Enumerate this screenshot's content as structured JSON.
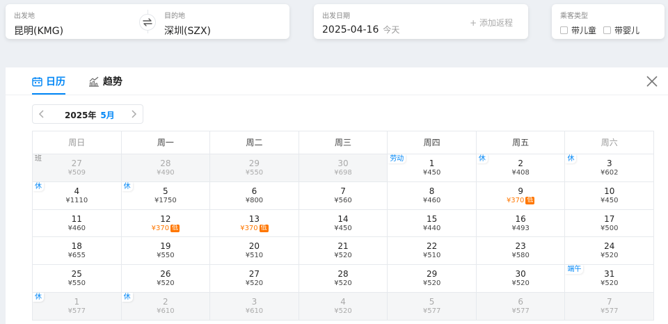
{
  "search": {
    "departure": {
      "label": "出发地",
      "value": "昆明(KMG)"
    },
    "arrival": {
      "label": "目的地",
      "value": "深圳(SZX)"
    },
    "date": {
      "label": "出发日期",
      "value": "2025-04-16",
      "today_tag": "今天"
    },
    "add_return": "+ 添加返程",
    "passenger": {
      "label": "乘客类型",
      "options": [
        "带儿童",
        "带婴儿"
      ]
    }
  },
  "panel": {
    "tabs": {
      "calendar": "日历",
      "trend": "趋势"
    },
    "year": "2025年",
    "month": "5月",
    "weekdays": [
      "周日",
      "周一",
      "周二",
      "周三",
      "周四",
      "周五",
      "周六"
    ],
    "weeks": [
      [
        {
          "day": "27",
          "price": "¥509",
          "dim": true,
          "tag": "班"
        },
        {
          "day": "28",
          "price": "¥490",
          "dim": true
        },
        {
          "day": "29",
          "price": "¥550",
          "dim": true
        },
        {
          "day": "30",
          "price": "¥698",
          "dim": true
        },
        {
          "day": "1",
          "price": "¥450",
          "tag": "劳动"
        },
        {
          "day": "2",
          "price": "¥408",
          "tag": "休"
        },
        {
          "day": "3",
          "price": "¥602",
          "tag": "休"
        }
      ],
      [
        {
          "day": "4",
          "price": "¥1110",
          "tag": "休"
        },
        {
          "day": "5",
          "price": "¥1750",
          "tag": "休"
        },
        {
          "day": "6",
          "price": "¥800"
        },
        {
          "day": "7",
          "price": "¥560"
        },
        {
          "day": "8",
          "price": "¥460"
        },
        {
          "day": "9",
          "price": "¥370",
          "low": true
        },
        {
          "day": "10",
          "price": "¥450"
        }
      ],
      [
        {
          "day": "11",
          "price": "¥460"
        },
        {
          "day": "12",
          "price": "¥370",
          "low": true
        },
        {
          "day": "13",
          "price": "¥370",
          "low": true
        },
        {
          "day": "14",
          "price": "¥450"
        },
        {
          "day": "15",
          "price": "¥440"
        },
        {
          "day": "16",
          "price": "¥493"
        },
        {
          "day": "17",
          "price": "¥500"
        }
      ],
      [
        {
          "day": "18",
          "price": "¥655"
        },
        {
          "day": "19",
          "price": "¥550"
        },
        {
          "day": "20",
          "price": "¥510"
        },
        {
          "day": "21",
          "price": "¥520"
        },
        {
          "day": "22",
          "price": "¥510"
        },
        {
          "day": "23",
          "price": "¥580"
        },
        {
          "day": "24",
          "price": "¥520"
        }
      ],
      [
        {
          "day": "25",
          "price": "¥550"
        },
        {
          "day": "26",
          "price": "¥520"
        },
        {
          "day": "27",
          "price": "¥520"
        },
        {
          "day": "28",
          "price": "¥520"
        },
        {
          "day": "29",
          "price": "¥520"
        },
        {
          "day": "30",
          "price": "¥520"
        },
        {
          "day": "31",
          "price": "¥520",
          "tag": "端午"
        }
      ],
      [
        {
          "day": "1",
          "price": "¥577",
          "dim": true,
          "tag": "休"
        },
        {
          "day": "2",
          "price": "¥610",
          "dim": true,
          "tag": "休"
        },
        {
          "day": "3",
          "price": "¥610",
          "dim": true
        },
        {
          "day": "4",
          "price": "¥520",
          "dim": true
        },
        {
          "day": "5",
          "price": "¥577",
          "dim": true
        },
        {
          "day": "6",
          "price": "¥577",
          "dim": true
        },
        {
          "day": "7",
          "price": "¥577",
          "dim": true
        }
      ]
    ],
    "low_badge": "低"
  },
  "colors": {
    "accent": "#0086f6",
    "low_price": "#ff7700"
  },
  "icons": {
    "swap": "swap-arrows-icon",
    "calendar": "calendar-icon",
    "trend": "trend-chart-icon",
    "close": "close-icon",
    "prev": "chevron-left-icon",
    "next": "chevron-right-icon"
  }
}
